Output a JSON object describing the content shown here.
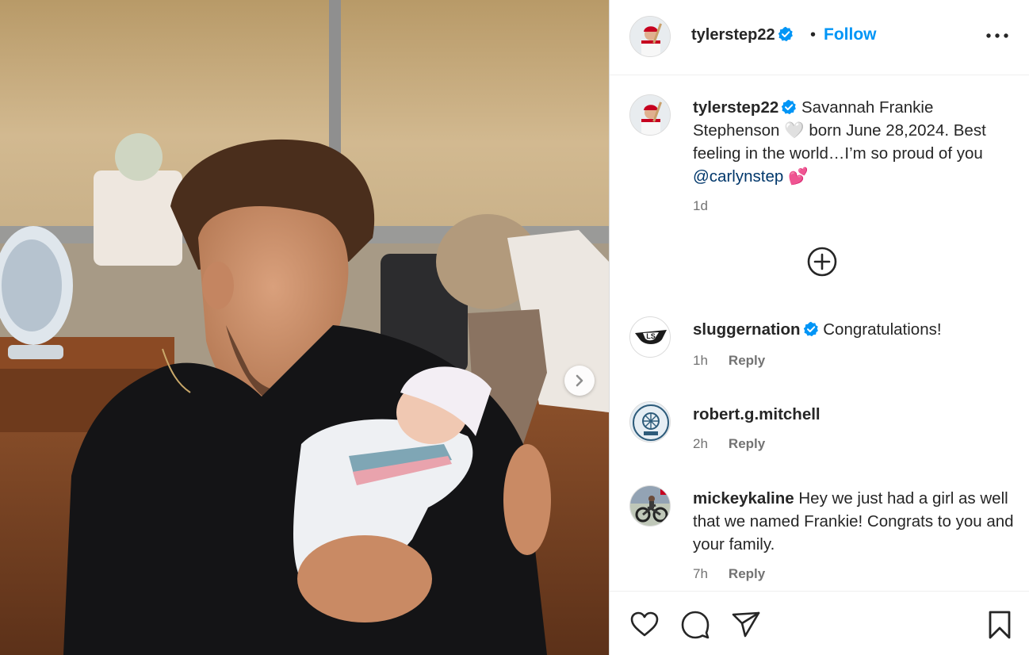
{
  "post": {
    "author": "tylerstep22",
    "separator": "•",
    "follow_label": "Follow",
    "caption": {
      "author": "tylerstep22",
      "text_1": "Savannah Frankie Stephenson",
      "heart_emoji": "🤍",
      "text_2": "born June 28,2024. Best feeling in the world…I’m so proud of you",
      "mention": "@carlynstep",
      "hearts_emoji": "💕",
      "time": "1d"
    }
  },
  "comments": [
    {
      "user": "sluggernation",
      "verified": true,
      "text": "Congratulations!",
      "time": "1h",
      "reply": "Reply"
    },
    {
      "user": "robert.g.mitchell",
      "verified": false,
      "text": "",
      "time": "2h",
      "reply": "Reply"
    },
    {
      "user": "mickeykaline",
      "verified": false,
      "text": "Hey we just had a girl as well that we named Frankie! Congrats to you and your family.",
      "time": "7h",
      "reply": "Reply"
    }
  ],
  "icons": {
    "verified": "verified-badge",
    "more": "more-options",
    "load_more": "plus-circle",
    "next": "chevron-right",
    "like": "heart",
    "comment": "speech-bubble",
    "share": "paper-plane",
    "save": "bookmark"
  },
  "colors": {
    "accent": "#0095f6",
    "verified": "#0095f6",
    "text": "#262626",
    "muted": "#737373",
    "mention": "#00376b"
  }
}
